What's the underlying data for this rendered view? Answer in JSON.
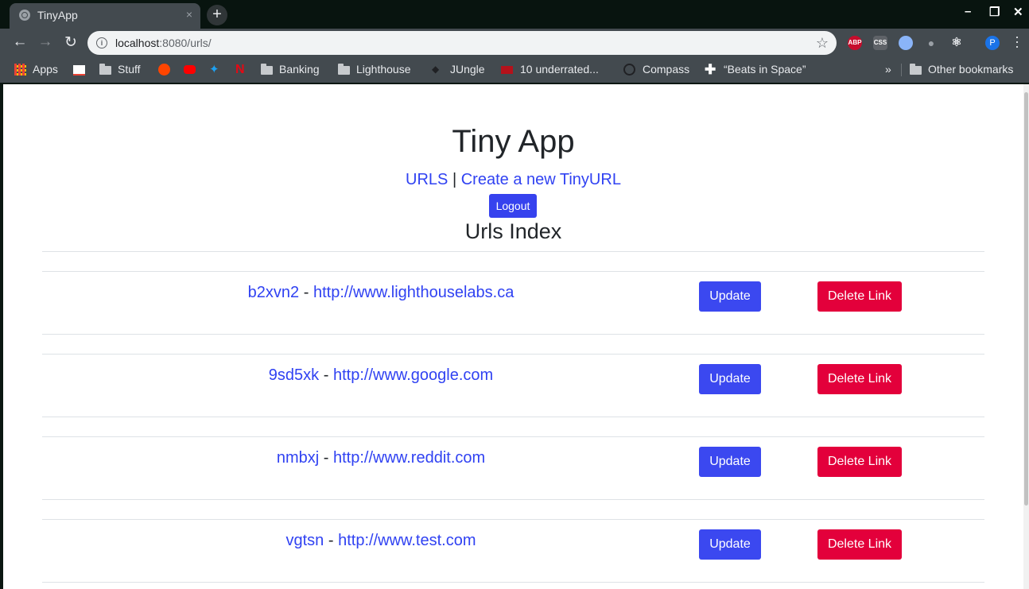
{
  "browser": {
    "tab_title": "TinyApp",
    "tab_close": "×",
    "new_tab": "+",
    "url_host": "localhost",
    "url_rest": ":8080/urls/",
    "window_controls": [
      "–",
      "❐",
      "✕"
    ],
    "extensions": [
      {
        "name": "adblock-plus-icon",
        "label": "ABP",
        "color": "#c70d2c"
      },
      {
        "name": "css-extension-icon",
        "label": "CSS",
        "color": "#5f6368"
      },
      {
        "name": "circle-extension-icon",
        "label": "",
        "color": "#8ab4f8"
      },
      {
        "name": "bulb-extension-icon",
        "label": "",
        "color": "#9aa0a6"
      },
      {
        "name": "react-devtools-icon",
        "label": "⚛",
        "color": "#434a4f"
      }
    ],
    "profile_initial": "P",
    "bookmarks": {
      "apps": "Apps",
      "stuff": "Stuff",
      "banking": "Banking",
      "lighthouse": "Lighthouse",
      "jungle": "JUngle",
      "underrated": "10 underrated...",
      "compass": "Compass",
      "beats": "“Beats in Space”",
      "overflow": "»",
      "other": "Other bookmarks"
    }
  },
  "page": {
    "title": "Tiny App",
    "nav": {
      "urls": "URLS",
      "separator": "|",
      "create": "Create a new TinyURL"
    },
    "logout_label": "Logout",
    "index_title": "Urls Index",
    "urls": [
      {
        "short": "b2xvn2",
        "long": "http://www.lighthouselabs.ca"
      },
      {
        "short": "9sd5xk",
        "long": "http://www.google.com"
      },
      {
        "short": "nmbxj",
        "long": "http://www.reddit.com"
      },
      {
        "short": "vgtsn",
        "long": "http://www.test.com"
      }
    ],
    "update_label": "Update",
    "delete_label": "Delete Link",
    "dash": "-"
  }
}
